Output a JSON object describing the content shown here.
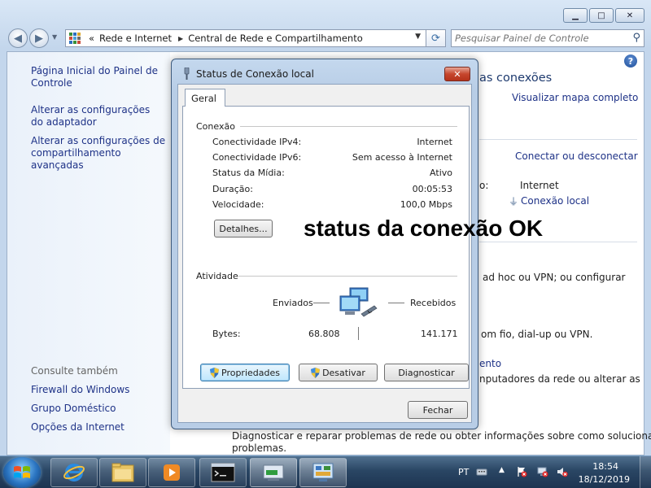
{
  "address": {
    "crumb_prefix": "«",
    "crumbs": [
      "Rede e Internet",
      "Central de Rede e Compartilhamento"
    ]
  },
  "search": {
    "placeholder": "Pesquisar Painel de Controle"
  },
  "left_pane": {
    "links": [
      "Página Inicial do Painel de Controle",
      "Alterar as configurações do adaptador",
      "Alterar as configurações de compartilhamento avançadas"
    ],
    "see_also_heading": "Consulte também",
    "see_also": [
      "Firewall do Windows",
      "Grupo Doméstico",
      "Opções da Internet"
    ]
  },
  "right_pane": {
    "heading_fragment": "as conexões",
    "view_full_map": "Visualizar mapa completo",
    "connect_disconnect": "Conectar ou desconectar",
    "access_label_fragment": "o:",
    "access_value": "Internet",
    "connections_link": "Conexão local",
    "frag_adhoc": "ad hoc ou VPN; ou configurar",
    "frag_wireless": "om fio, dial-up ou VPN.",
    "frag_link": "ento",
    "frag_computers": "nputadores da rede ou alterar as",
    "diagnose_text": "Diagnosticar e reparar problemas de rede ou obter informações sobre como solucionar",
    "diagnose_text2": "problemas."
  },
  "dialog": {
    "title": "Status de Conexão local",
    "tab": "Geral",
    "connection_group": "Conexão",
    "rows": [
      {
        "label": "Conectividade IPv4:",
        "value": "Internet"
      },
      {
        "label": "Conectividade IPv6:",
        "value": "Sem acesso à Internet"
      },
      {
        "label": "Status da Mídia:",
        "value": "Ativo"
      },
      {
        "label": "Duração:",
        "value": "00:05:53"
      },
      {
        "label": "Velocidade:",
        "value": "100,0 Mbps"
      }
    ],
    "details_button": "Detalhes...",
    "activity_group": "Atividade",
    "sent_label": "Enviados",
    "received_label": "Recebidos",
    "bytes_label": "Bytes:",
    "bytes_sent": "68.808",
    "bytes_received": "141.171",
    "properties_button": "Propriedades",
    "disable_button": "Desativar",
    "diagnose_button": "Diagnosticar",
    "close_button": "Fechar"
  },
  "overlay_text": "status da conexão OK",
  "taskbar": {
    "language": "PT",
    "time": "18:54",
    "date": "18/12/2019"
  }
}
